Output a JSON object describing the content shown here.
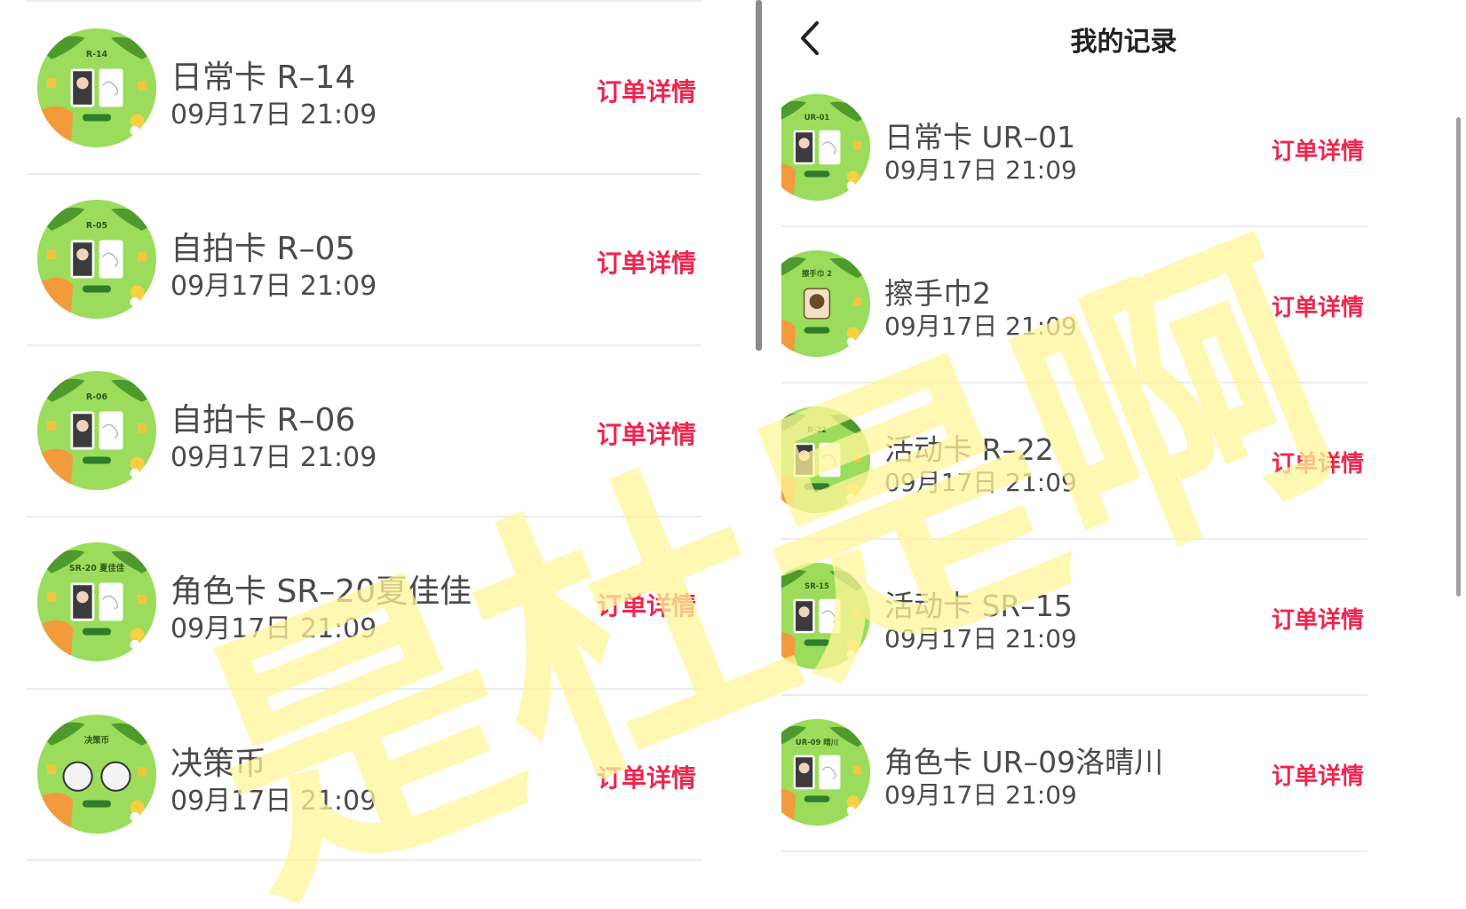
{
  "header": {
    "title": "我的记录",
    "back_icon": "chevron-left-icon"
  },
  "colors": {
    "accent": "#f0254e",
    "thumb_green": "#9bdc5c",
    "watermark": "#fff59a"
  },
  "watermark_text": "是杜是啊",
  "left_list": [
    {
      "badge": "R-14",
      "title": "日常卡 R–14",
      "time": "09月17日  21:09",
      "action": "订单详情"
    },
    {
      "badge": "R-05",
      "title": "自拍卡 R–05",
      "time": "09月17日  21:09",
      "action": "订单详情"
    },
    {
      "badge": "R-06",
      "title": "自拍卡 R–06",
      "time": "09月17日  21:09",
      "action": "订单详情"
    },
    {
      "badge": "SR-20 夏佳佳",
      "title": "角色卡 SR–20夏佳佳",
      "time": "09月17日  21:09",
      "action": "订单详情"
    },
    {
      "badge": "决策币",
      "title": "决策币",
      "time": "09月17日  21:09",
      "action": "订单详情"
    }
  ],
  "right_list": [
    {
      "badge": "UR-01",
      "title": "日常卡 UR–01",
      "time": "09月17日  21:09",
      "action": "订单详情"
    },
    {
      "badge": "擦手巾 2",
      "title": "擦手巾2",
      "time": "09月17日  21:09",
      "action": "订单详情"
    },
    {
      "badge": "R-22",
      "title": "活动卡 R–22",
      "time": "09月17日  21:09",
      "action": "订单详情"
    },
    {
      "badge": "SR-15",
      "title": "活动卡 SR–15",
      "time": "09月17日  21:09",
      "action": "订单详情"
    },
    {
      "badge": "UR-09 晴川",
      "title": "角色卡 UR–09洛晴川",
      "time": "09月17日  21:09",
      "action": "订单详情"
    }
  ]
}
